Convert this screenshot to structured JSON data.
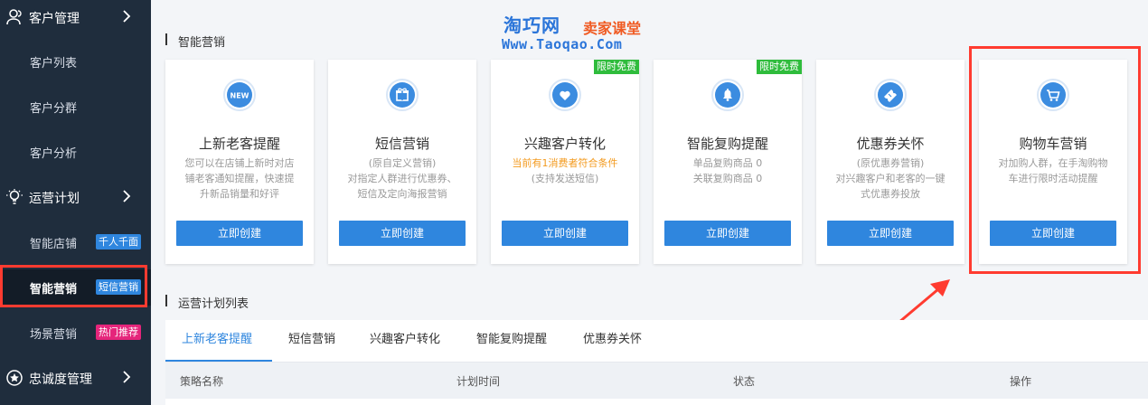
{
  "sidebar": {
    "groups": [
      {
        "label": "客户管理",
        "icon": "user-group-icon"
      },
      {
        "label": "运营计划",
        "icon": "lightbulb-icon"
      },
      {
        "label": "忠诚度管理",
        "icon": "star-badge-icon"
      }
    ],
    "items": [
      {
        "label": "客户列表"
      },
      {
        "label": "客户分群"
      },
      {
        "label": "客户分析"
      },
      {
        "label": "智能店铺",
        "badge": "千人千面",
        "badge_color": "#2f86de"
      },
      {
        "label": "智能营销",
        "badge": "短信营销",
        "badge_color": "#2f86de"
      },
      {
        "label": "场景营销",
        "badge": "热门推荐",
        "badge_color": "#e5257b"
      }
    ]
  },
  "watermark": {
    "cn": "淘巧网",
    "cn2": "卖家课堂",
    "en": "Www.Taoqao.Com"
  },
  "main": {
    "section_title": "智能营销",
    "cards": [
      {
        "title": "上新老客提醒",
        "desc": [
          "您可以在店铺上新时对店",
          "铺老客通知提醒，快速提",
          "升新品销量和好评"
        ],
        "button": "立即创建",
        "icon": "new-badge-icon"
      },
      {
        "title": "短信营销",
        "desc": [
          "(原自定义营销)",
          "对指定人群进行优惠券、",
          "短信及定向海报营销"
        ],
        "button": "立即创建",
        "icon": "gift-icon"
      },
      {
        "title": "兴趣客户转化",
        "desc_orange": "当前有1消费者符合条件",
        "desc": [
          "(支持发送短信)"
        ],
        "button": "立即创建",
        "icon": "heart-icon",
        "ribbon": "限时免费"
      },
      {
        "title": "智能复购提醒",
        "desc": [
          "单品复购商品 0",
          "关联复购商品 0"
        ],
        "button": "立即创建",
        "icon": "bell-icon",
        "ribbon": "限时免费"
      },
      {
        "title": "优惠券关怀",
        "desc": [
          "(原优惠券营销)",
          "对兴趣客户和老客的一键",
          "式优惠券投放"
        ],
        "button": "立即创建",
        "icon": "ticket-icon"
      },
      {
        "title": "购物车营销",
        "desc": [
          "对加购人群，在手淘购物",
          "车进行限时活动提醒"
        ],
        "button": "立即创建",
        "icon": "cart-icon"
      }
    ],
    "plan_section_title": "运营计划列表",
    "tabs": [
      "上新老客提醒",
      "短信营销",
      "兴趣客户转化",
      "智能复购提醒",
      "优惠券关怀"
    ],
    "table_headers": [
      "策略名称",
      "计划时间",
      "状态",
      "操作"
    ]
  }
}
